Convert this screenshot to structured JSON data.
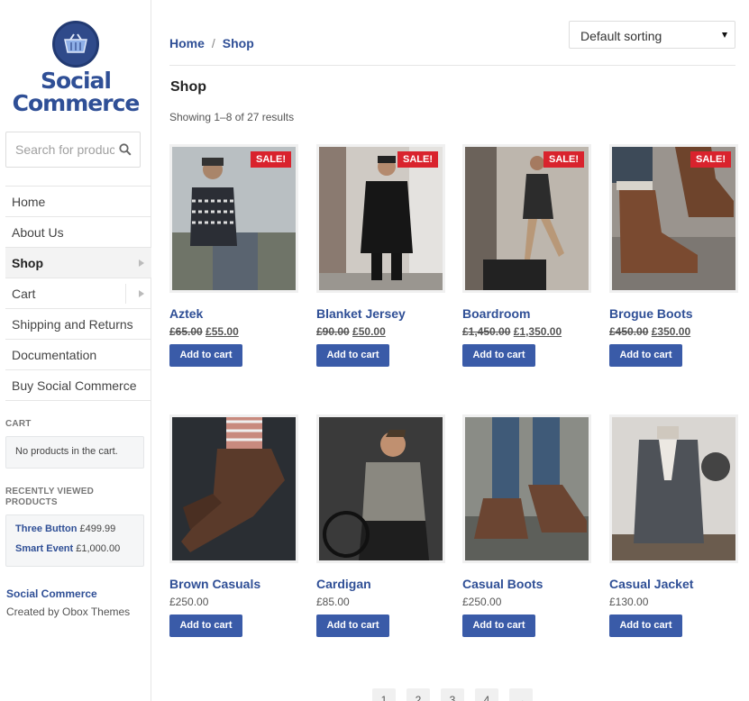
{
  "brand": {
    "name_line1": "Social",
    "name_line2": "Commerce"
  },
  "search": {
    "placeholder": "Search for products"
  },
  "nav": {
    "items": [
      {
        "label": "Home"
      },
      {
        "label": "About Us"
      },
      {
        "label": "Shop"
      },
      {
        "label": "Cart"
      },
      {
        "label": "Shipping and Returns"
      },
      {
        "label": "Documentation"
      },
      {
        "label": "Buy Social Commerce"
      }
    ]
  },
  "cart_widget": {
    "title": "CART",
    "empty_text": "No products in the cart."
  },
  "recent_widget": {
    "title_line1": "RECENTLY VIEWED",
    "title_line2": "PRODUCTS",
    "items": [
      {
        "name": "Three Button",
        "price": "£499.99"
      },
      {
        "name": "Smart Event",
        "price": "£1,000.00"
      }
    ]
  },
  "footer": {
    "title": "Social Commerce",
    "credit": "Created by Obox Themes"
  },
  "breadcrumb": {
    "home": "Home",
    "separator": "/",
    "current": "Shop"
  },
  "sorting": {
    "selected": "Default sorting"
  },
  "page": {
    "title": "Shop",
    "result_count": "Showing 1–8 of 27 results"
  },
  "products": [
    {
      "name": "Aztek",
      "old_price": "£65.00",
      "price": "£55.00",
      "sale": "SALE!",
      "button": "Add to cart"
    },
    {
      "name": "Blanket Jersey",
      "old_price": "£90.00",
      "price": "£50.00",
      "sale": "SALE!",
      "button": "Add to cart"
    },
    {
      "name": "Boardroom",
      "old_price": "£1,450.00",
      "price": "£1,350.00",
      "sale": "SALE!",
      "button": "Add to cart"
    },
    {
      "name": "Brogue Boots",
      "old_price": "£450.00",
      "price": "£350.00",
      "sale": "SALE!",
      "button": "Add to cart"
    },
    {
      "name": "Brown Casuals",
      "price": "£250.00",
      "button": "Add to cart"
    },
    {
      "name": "Cardigan",
      "price": "£85.00",
      "button": "Add to cart"
    },
    {
      "name": "Casual Boots",
      "price": "£250.00",
      "button": "Add to cart"
    },
    {
      "name": "Casual Jacket",
      "price": "£130.00",
      "button": "Add to cart"
    }
  ],
  "pagination": [
    "1",
    "2",
    "3",
    "4",
    "→"
  ],
  "colors": {
    "brand_blue": "#2f4f96",
    "button_blue": "#3a5ba8",
    "sale_red": "#d9232d"
  }
}
